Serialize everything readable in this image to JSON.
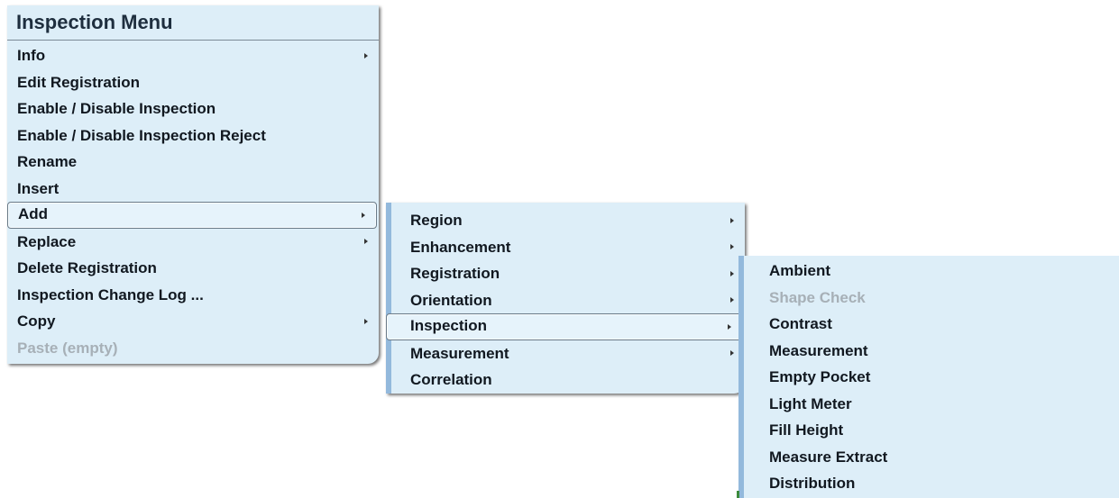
{
  "main_menu": {
    "title": "Inspection Menu",
    "items": [
      {
        "label": "Info",
        "has_submenu": true,
        "enabled": true
      },
      {
        "label": "Edit Registration",
        "has_submenu": false,
        "enabled": true
      },
      {
        "label": "Enable / Disable Inspection",
        "has_submenu": false,
        "enabled": true
      },
      {
        "label": "Enable / Disable Inspection Reject",
        "has_submenu": false,
        "enabled": true
      },
      {
        "label": "Rename",
        "has_submenu": false,
        "enabled": true
      },
      {
        "label": "Insert",
        "has_submenu": false,
        "enabled": true
      },
      {
        "label": "Add",
        "has_submenu": true,
        "enabled": true,
        "highlighted": true
      },
      {
        "label": "Replace",
        "has_submenu": true,
        "enabled": true
      },
      {
        "label": "Delete Registration",
        "has_submenu": false,
        "enabled": true
      },
      {
        "label": "Inspection Change Log ...",
        "has_submenu": false,
        "enabled": true
      },
      {
        "label": "Copy",
        "has_submenu": true,
        "enabled": true
      },
      {
        "label": "Paste (empty)",
        "has_submenu": false,
        "enabled": false
      }
    ]
  },
  "add_submenu": {
    "items": [
      {
        "label": "Region",
        "has_submenu": true
      },
      {
        "label": "Enhancement",
        "has_submenu": true
      },
      {
        "label": "Registration",
        "has_submenu": true
      },
      {
        "label": "Orientation",
        "has_submenu": true
      },
      {
        "label": "Inspection",
        "has_submenu": true,
        "highlighted": true
      },
      {
        "label": "Measurement",
        "has_submenu": true
      },
      {
        "label": "Correlation",
        "has_submenu": false
      }
    ]
  },
  "inspection_submenu": {
    "items": [
      {
        "label": "Ambient",
        "enabled": true
      },
      {
        "label": "Shape Check",
        "enabled": false
      },
      {
        "label": "Contrast",
        "enabled": true
      },
      {
        "label": "Measurement",
        "enabled": true
      },
      {
        "label": "Empty Pocket",
        "enabled": true
      },
      {
        "label": "Light Meter",
        "enabled": true
      },
      {
        "label": "Fill Height",
        "enabled": true
      },
      {
        "label": "Measure Extract",
        "enabled": true
      },
      {
        "label": "Distribution",
        "enabled": true
      }
    ]
  },
  "colors": {
    "menu_background": "#ddeef8",
    "submenu_left_bar": "#93b9dc",
    "text": "#111820",
    "disabled_text": "#a7b0b7"
  }
}
